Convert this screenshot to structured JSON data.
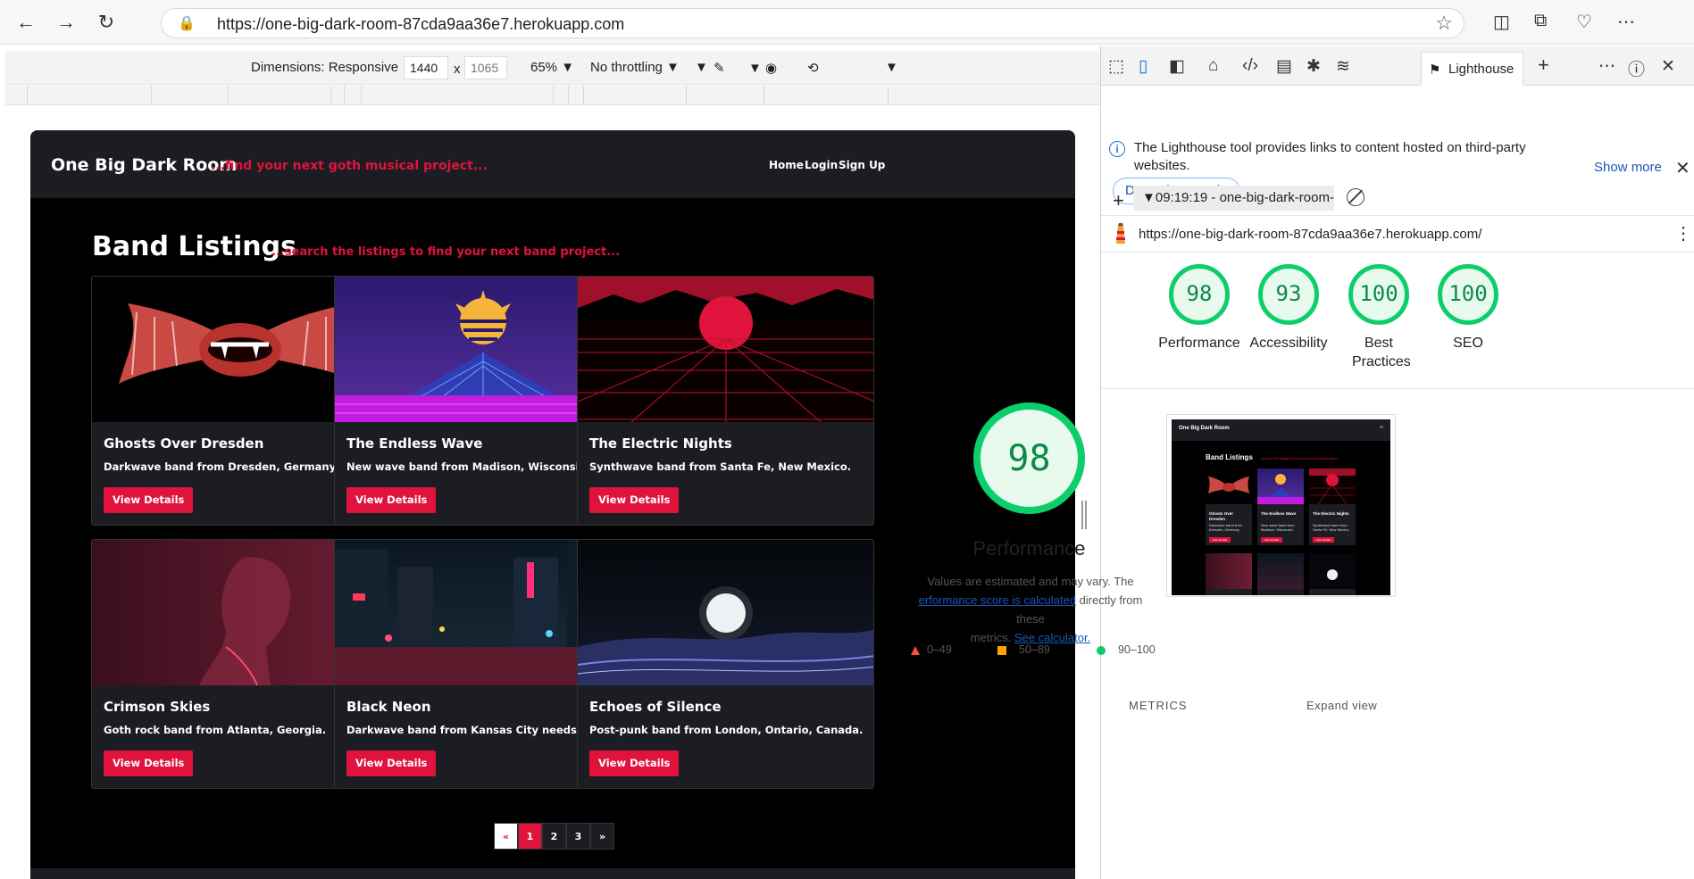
{
  "browser": {
    "url": "https://one-big-dark-room-87cda9aa36e7.herokuapp.com"
  },
  "device_toolbar": {
    "dimensions": "Dimensions: Responsive",
    "width": "1440",
    "x_sep": "x",
    "height": "1065",
    "zoom": "65%",
    "throttling": "No throttling"
  },
  "site": {
    "brand": "One Big Dark Room",
    "tagline": "...find your next goth musical project...",
    "nav": [
      "Home",
      "Login",
      "Sign Up"
    ],
    "listings_title": "Band Listings",
    "listings_sub": "...search the listings to find your next band project...",
    "cards": [
      {
        "name": "Ghosts Over Dresden",
        "desc": "Darkwave band from Dresden, Germany",
        "button": "View Details"
      },
      {
        "name": "The Endless Wave",
        "desc": "New wave band from Madison, Wisconsin.",
        "button": "View Details"
      },
      {
        "name": "The Electric Nights",
        "desc": "Synthwave band from Santa Fe, New Mexico.",
        "button": "View Details"
      },
      {
        "name": "Crimson Skies",
        "desc": "Goth rock band from Atlanta, Georgia.",
        "button": "View Details"
      },
      {
        "name": "Black Neon",
        "desc": "Darkwave band from Kansas City needs a guitarist.",
        "button": "View Details"
      },
      {
        "name": "Echoes of Silence",
        "desc": "Post-punk band from London, Ontario, Canada.",
        "button": "View Details"
      }
    ],
    "pagination": [
      "«",
      "1",
      "2",
      "3",
      "»"
    ],
    "active_page": "1"
  },
  "devtools": {
    "active_tab": "Lighthouse",
    "notice": "The Lighthouse tool provides links to content hosted on third-party websites.",
    "show_more": "Show more",
    "dont_show": "Don't show again",
    "report_selector": "09:19:19 - one-big-dark-room-",
    "report_url": "https://one-big-dark-room-87cda9aa36e7.herokuapp.com/",
    "scores": [
      {
        "label": "Performance",
        "value": "98"
      },
      {
        "label": "Accessibility",
        "value": "93"
      },
      {
        "label": "Best Practices",
        "value": "100"
      },
      {
        "label": "SEO",
        "value": "100"
      }
    ],
    "perf_big_score": "98",
    "perf_title": "Performance",
    "perf_note_1": "Values are estimated and may vary. The",
    "perf_note_link1": "erformance score is calculated",
    "perf_note_2": "directly from these",
    "perf_note_3": "metrics.",
    "perf_note_link2": "See calculator.",
    "legend": [
      "0–49",
      "50–89",
      "90–100"
    ],
    "metrics_label": "METRICS",
    "expand_view": "Expand view",
    "thumb": {
      "brand": "One Big Dark Room",
      "title": "Band Listings",
      "sub": "...search the listings to find your next band project...",
      "cards": [
        {
          "name": "Ghosts Over Dresden",
          "desc": "Darkwave band from Dresden, Germany",
          "button": "View Details"
        },
        {
          "name": "The Endless Wave",
          "desc": "New wave band from Madison, Wisconsin.",
          "button": "View Details"
        },
        {
          "name": "The Electric Nights",
          "desc": "Synthwave band from Santa Fe, New Mexico.",
          "button": "View Details"
        }
      ]
    }
  },
  "colors": {
    "accent_red": "#e0133d",
    "score_green": "#0cce6b",
    "legend_red": "#ff4e42",
    "legend_orange": "#ffa400"
  }
}
